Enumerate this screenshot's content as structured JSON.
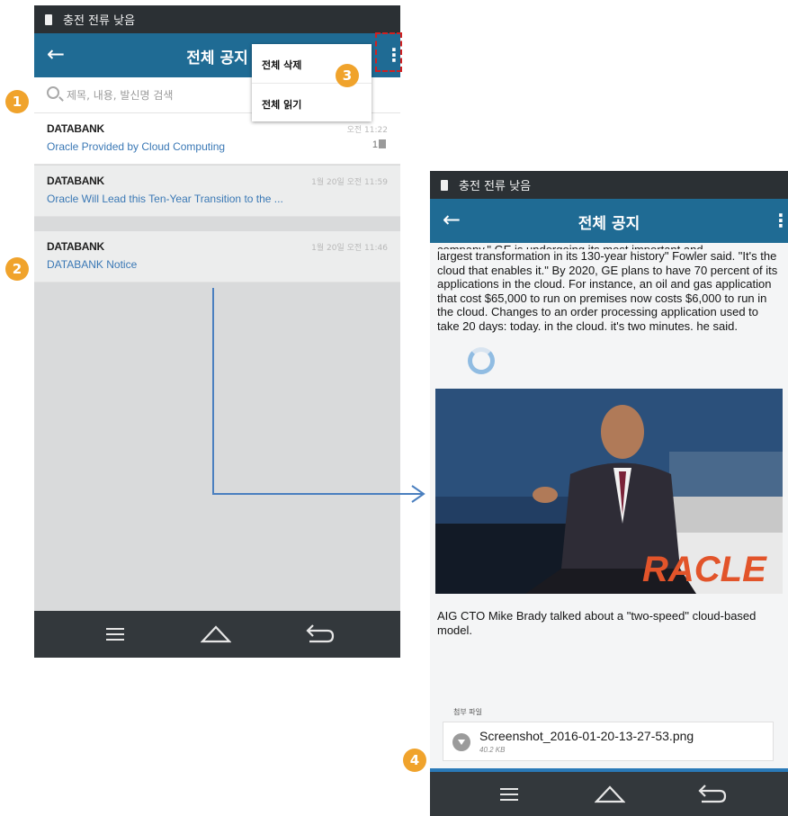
{
  "status_bar": {
    "text": "충전 전류 낮음"
  },
  "phone1": {
    "title": "전체 공지",
    "search_placeholder": "제목, 내용, 발신명 검색",
    "menu": [
      "전체 삭제",
      "전체 읽기"
    ],
    "rows": [
      {
        "sender": "DATABANK",
        "subject": "Oracle Provided by Cloud Computing",
        "time": "오전 11:22",
        "count": "1"
      },
      {
        "sender": "DATABANK",
        "subject": "Oracle Will Lead this Ten-Year Transition to the ...",
        "time": "1월 20일 오전 11:59",
        "count": ""
      },
      {
        "sender": "DATABANK",
        "subject": "DATABANK Notice",
        "time": "1월 20일 오전 11:46",
        "count": ""
      }
    ]
  },
  "phone2": {
    "title": "전체 공지",
    "article": "largest transformation in its 130-year history\" Fowler said. \"It's the cloud that enables it.\" By 2020, GE plans to have 70 percent of its applications in the cloud. For instance, an oil and gas application that cost $65,000 to run on premises now costs $6,000 to run in the cloud. Changes to an order processing application used to take 20 days: today. in the cloud. it's two minutes. he said.",
    "article_top": "company.\" GE is undergoing its most important and",
    "photo_text": "RACLE",
    "caption": "AIG CTO Mike Brady talked about a \"two-speed\" cloud-based model.",
    "attachment_label": "첨부 파일",
    "attachment_name": "Screenshot_2016-01-20-13-27-53.png",
    "attachment_size": "40.2 KB"
  },
  "badges": [
    "1",
    "2",
    "3",
    "4"
  ],
  "colors": {
    "appbar": "#1f6b94",
    "badge": "#f0a32c",
    "arrow": "#4a7fbf",
    "highlight": "#d02020"
  }
}
